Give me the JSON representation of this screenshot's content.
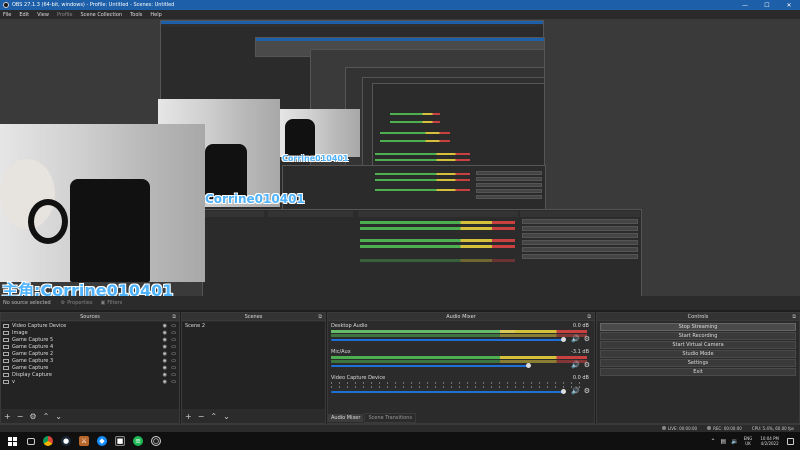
{
  "window": {
    "title": "OBS 27.1.3 (64-bit, windows) - Profile: Untitled - Scenes: Untitled",
    "minimize": "—",
    "maximize": "☐",
    "close": "✕"
  },
  "menu": {
    "items": [
      {
        "label": "File"
      },
      {
        "label": "Edit"
      },
      {
        "label": "View"
      },
      {
        "label": "Profile",
        "dim": true
      },
      {
        "label": "Scene Collection"
      },
      {
        "label": "Tools"
      },
      {
        "label": "Help"
      }
    ]
  },
  "preview": {
    "overlay_large": "主角:Corrine010401",
    "overlay_mid": "Corrine010401",
    "overlay_small": "Corrine010401"
  },
  "sourcebar": {
    "no_source": "No source selected",
    "properties": "Properties",
    "filters": "Filters"
  },
  "sources": {
    "title": "Sources",
    "items": [
      {
        "label": "Video Capture Device"
      },
      {
        "label": "Image"
      },
      {
        "label": "Game Capture 5"
      },
      {
        "label": "Game Capture 4"
      },
      {
        "label": "Game Capture 2"
      },
      {
        "label": "Game Capture 3"
      },
      {
        "label": "Game Capture"
      },
      {
        "label": "Display Capture"
      },
      {
        "label": "v"
      }
    ]
  },
  "scenes": {
    "title": "Scenes",
    "items": [
      {
        "label": "Scene 2"
      }
    ]
  },
  "mixer": {
    "title": "Audio Mixer",
    "channels": [
      {
        "name": "Desktop Audio",
        "db": "0.0 dB",
        "level": 0.72
      },
      {
        "name": "Mic/Aux",
        "db": "-3.1 dB",
        "level": 0.88
      },
      {
        "name": "Video Capture Device",
        "db": "0.0 dB",
        "level": 0.0
      }
    ],
    "tabs": [
      {
        "label": "Audio Mixer"
      },
      {
        "label": "Scene Transitions"
      }
    ]
  },
  "controls": {
    "title": "Controls",
    "buttons": [
      {
        "label": "Stop Streaming"
      },
      {
        "label": "Start Recording"
      },
      {
        "label": "Start Virtual Camera"
      },
      {
        "label": "Studio Mode"
      },
      {
        "label": "Settings"
      },
      {
        "label": "Exit"
      }
    ]
  },
  "status": {
    "live": "LIVE: 00:00:00",
    "rec": "REC: 00:00:00",
    "cpu": "CPU: 5.4%, 60.00 fps"
  },
  "taskbar": {
    "lang1": "ENG",
    "lang2": "UK",
    "time": "10:04 PM",
    "date": "4/2/2022"
  },
  "colors": {
    "accent": "#1e6fd6",
    "titlebar": "#1d5fa8",
    "overlay": "#4fb3ff"
  }
}
